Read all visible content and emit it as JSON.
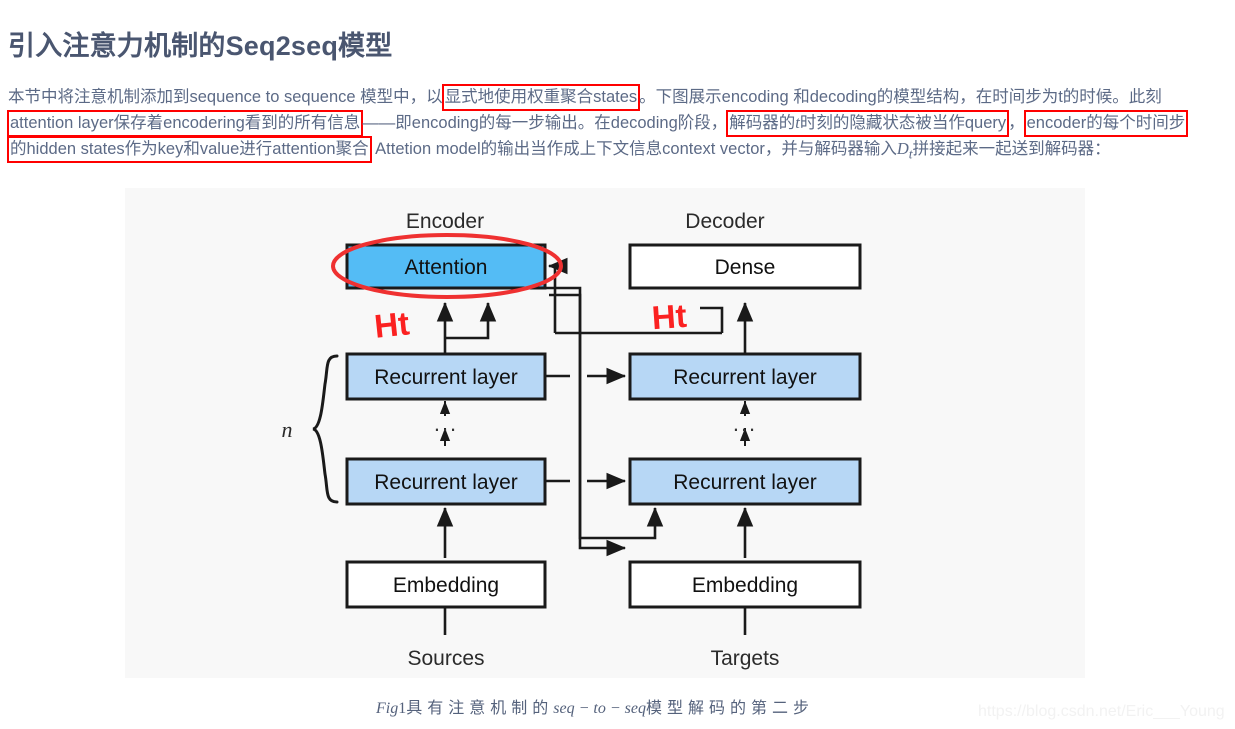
{
  "page": {
    "title": "引入注意力机制的Seq2seq模型",
    "title_color": "#4a5670",
    "body_text_color": "#5c6a86",
    "highlight_color": "#ff0000",
    "figure_bg": "#f8f8f8"
  },
  "paragraph": {
    "s1": "本节中将注意机制添加到sequence to sequence 模型中，以",
    "h1": "显式地使用权重聚合states",
    "s2": "。下图展示encoding 和decoding的模型结构，在时间步为t的时候。此刻",
    "h2": "attention layer保存着encodering看到的所有信息",
    "s3": "——即encoding的每一步输出。在decoding阶段，",
    "h3_a": "解码器的",
    "h3_it": "t",
    "h3_b": "时刻的隐藏状态被当作query",
    "s4": "，",
    "h4": "encoder的每个时间步",
    "h5": "的hidden states作为key和value进行attention聚合",
    "s5": "Attetion model的输出当作成上下文信息context vector，并与解码器输入",
    "s5_it": "D",
    "s5_sub": "t",
    "s6": "拼接起来一起送到解码器："
  },
  "figure": {
    "encoder_label": "Encoder",
    "decoder_label": "Decoder",
    "attention_box": "Attention",
    "dense_box": "Dense",
    "recurrent_box": "Recurrent layer",
    "embedding_box": "Embedding",
    "sources_label": "Sources",
    "targets_label": "Targets",
    "ellipsis": "...",
    "n_label": "n",
    "annotation_ht_left": "Ht",
    "annotation_ht_right": "Ht",
    "colors": {
      "attention_fill": "#54bcf5",
      "recurrent_fill": "#b7d7f5",
      "plain_fill": "#ffffff",
      "stroke": "#1a1a1a",
      "annotation": "#fb2121",
      "highlight_ellipse": "#ef3131"
    }
  },
  "caption": {
    "fig_no": "Fig",
    "fig_num": "1",
    "text_a": "具有注意机制的",
    "math": "seq − to − seq",
    "text_b": "模型解码的第二步"
  },
  "watermark": {
    "url": "https://blog.csdn.net/Eric___Young"
  }
}
